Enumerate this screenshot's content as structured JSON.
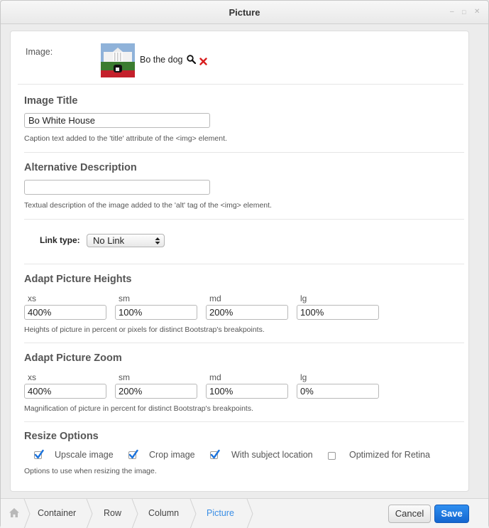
{
  "window": {
    "title": "Picture"
  },
  "image": {
    "label": "Image:",
    "file_name": "Bo the dog"
  },
  "image_title": {
    "heading": "Image Title",
    "value": "Bo White House",
    "help": "Caption text added to the 'title' attribute of the <img> element."
  },
  "alt_description": {
    "heading": "Alternative Description",
    "value": "",
    "help": "Textual description of the image added to the 'alt' tag of the <img> element."
  },
  "link": {
    "label": "Link type:",
    "selected": "No Link"
  },
  "heights": {
    "heading": "Adapt Picture Heights",
    "breakpoints": [
      {
        "label": "xs",
        "value": "400%"
      },
      {
        "label": "sm",
        "value": "100%"
      },
      {
        "label": "md",
        "value": "200%"
      },
      {
        "label": "lg",
        "value": "100%"
      }
    ],
    "help": "Heights of picture in percent or pixels for distinct Bootstrap's breakpoints."
  },
  "zoom": {
    "heading": "Adapt Picture Zoom",
    "breakpoints": [
      {
        "label": "xs",
        "value": "400%"
      },
      {
        "label": "sm",
        "value": "200%"
      },
      {
        "label": "md",
        "value": "100%"
      },
      {
        "label": "lg",
        "value": "0%"
      }
    ],
    "help": "Magnification of picture in percent for distinct Bootstrap's breakpoints."
  },
  "resize": {
    "heading": "Resize Options",
    "options": [
      {
        "label": "Upscale image",
        "checked": true
      },
      {
        "label": "Crop image",
        "checked": true
      },
      {
        "label": "With subject location",
        "checked": true
      },
      {
        "label": "Optimized for Retina",
        "checked": false
      }
    ],
    "help": "Options to use when resizing the image."
  },
  "breadcrumb": {
    "items": [
      {
        "label": "Container"
      },
      {
        "label": "Row"
      },
      {
        "label": "Column"
      },
      {
        "label": "Picture"
      }
    ]
  },
  "actions": {
    "cancel_label": "Cancel",
    "save_label": "Save"
  },
  "colors": {
    "accent": "#1a72dc",
    "delete": "#d81e1e",
    "breadcrumb_active": "#3a8ee6"
  }
}
